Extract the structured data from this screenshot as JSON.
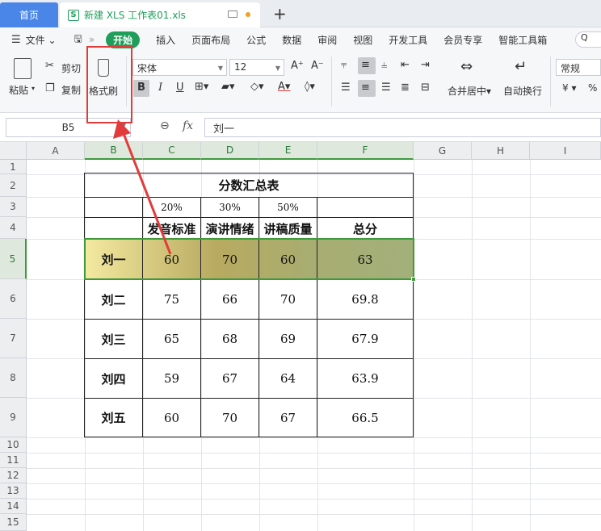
{
  "tabs": {
    "home": "首页",
    "document": "新建 XLS 工作表01.xls"
  },
  "menu": {
    "file": "文件",
    "items": [
      "开始",
      "插入",
      "页面布局",
      "公式",
      "数据",
      "审阅",
      "视图",
      "开发工具",
      "会员专享",
      "智能工具箱"
    ],
    "search": "Q"
  },
  "ribbon": {
    "paste": "粘贴",
    "cut": "剪切",
    "copy": "复制",
    "format_painter": "格式刷",
    "font_name": "宋体",
    "font_size": "12",
    "bold": "B",
    "italic": "I",
    "underline": "U",
    "merge_center": "合并居中",
    "wrap_text": "自动换行",
    "number_format": "常规",
    "currency": "¥",
    "percent": "%"
  },
  "formula_bar": {
    "cell_ref": "B5",
    "fx": "fx",
    "value": "刘一"
  },
  "columns": [
    "A",
    "B",
    "C",
    "D",
    "E",
    "F",
    "G",
    "H",
    "I"
  ],
  "rows": [
    "1",
    "2",
    "3",
    "4",
    "5",
    "6",
    "7",
    "8",
    "9",
    "10",
    "11",
    "12",
    "13",
    "14",
    "15"
  ],
  "sheet": {
    "title": "分数汇总表",
    "weights": [
      "20%",
      "30%",
      "50%"
    ],
    "headers": [
      "发音标准",
      "演讲情绪",
      "讲稿质量",
      "总分"
    ],
    "records": [
      {
        "name": "刘一",
        "scores": [
          "60",
          "70",
          "60"
        ],
        "total": "63"
      },
      {
        "name": "刘二",
        "scores": [
          "75",
          "66",
          "70"
        ],
        "total": "69.8"
      },
      {
        "name": "刘三",
        "scores": [
          "65",
          "68",
          "69"
        ],
        "total": "67.9"
      },
      {
        "name": "刘四",
        "scores": [
          "59",
          "67",
          "64"
        ],
        "total": "63.9"
      },
      {
        "name": "刘五",
        "scores": [
          "60",
          "70",
          "67"
        ],
        "total": "66.5"
      }
    ]
  },
  "colors": {
    "accent": "#1e9e5a",
    "annotation": "#e23b3b",
    "selection": "#3d9a3d"
  }
}
